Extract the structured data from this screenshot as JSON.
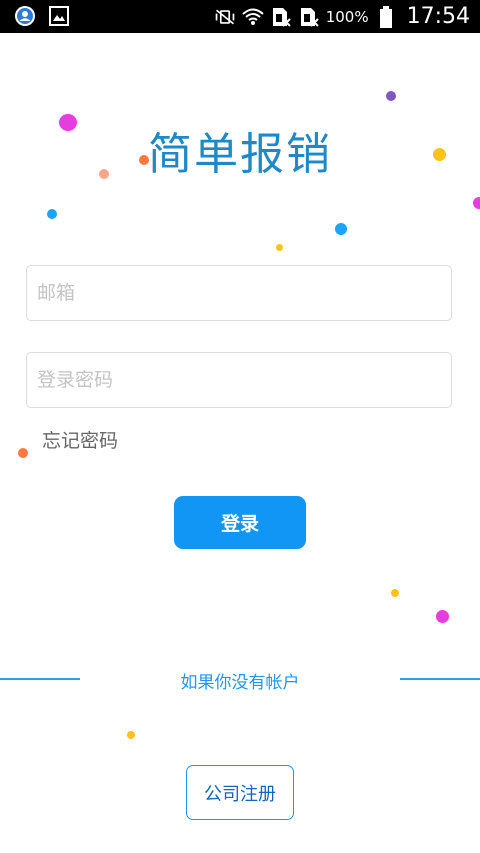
{
  "status_bar": {
    "battery": "100%",
    "time": "17:54",
    "left_icons": [
      "contact-icon",
      "image-icon"
    ],
    "right_icons": [
      "vibrate-off-icon",
      "wifi-icon",
      "no-sim-icon",
      "no-sim-icon",
      "battery-icon"
    ]
  },
  "app": {
    "title": "简单报销"
  },
  "login": {
    "email_placeholder": "邮箱",
    "password_placeholder": "登录密码",
    "forgot_password": "忘记密码",
    "login_button": "登录"
  },
  "register": {
    "prompt": "如果你没有帐户",
    "company_register_button": "公司注册"
  },
  "colors": {
    "brand_blue": "#1196f5",
    "title_blue": "#1e88c8",
    "dots": [
      "#e63de0",
      "#ff7a3d",
      "#ffa58a",
      "#1aa3ff",
      "#ffc21a",
      "#7e57c2"
    ]
  }
}
